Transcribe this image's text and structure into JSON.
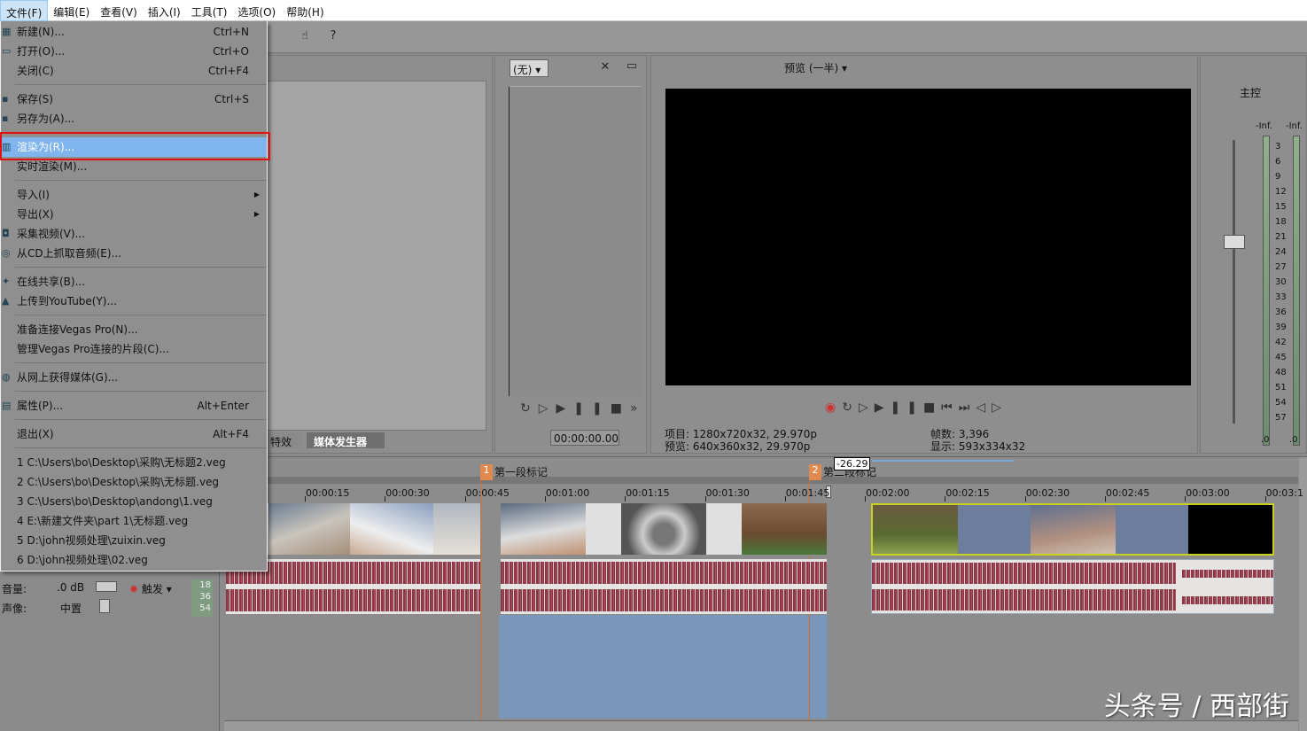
{
  "menubar": [
    "文件(F)",
    "编辑(E)",
    "查看(V)",
    "插入(I)",
    "工具(T)",
    "选项(O)",
    "帮助(H)"
  ],
  "file_menu": [
    {
      "label": "新建(N)...",
      "shortcut": "Ctrl+N",
      "icon": "new-project-icon"
    },
    {
      "label": "打开(O)...",
      "shortcut": "Ctrl+O",
      "icon": "folder-icon"
    },
    {
      "label": "关闭(C)",
      "shortcut": "Ctrl+F4"
    },
    {
      "sep": true
    },
    {
      "label": "保存(S)",
      "shortcut": "Ctrl+S",
      "icon": "save-icon"
    },
    {
      "label": "另存为(A)...",
      "icon": "save-as-icon"
    },
    {
      "sep": true
    },
    {
      "label": "渲染为(R)...",
      "icon": "render-icon",
      "highlighted": true
    },
    {
      "label": "实时渲染(M)..."
    },
    {
      "sep": true
    },
    {
      "label": "导入(I)",
      "submenu": true
    },
    {
      "label": "导出(X)",
      "submenu": true
    },
    {
      "label": "采集视频(V)...",
      "icon": "capture-video-icon"
    },
    {
      "label": "从CD上抓取音频(E)...",
      "icon": "cd-icon"
    },
    {
      "sep": true
    },
    {
      "label": "在线共享(B)...",
      "icon": "share-icon"
    },
    {
      "label": "上传到YouTube(Y)...",
      "icon": "upload-icon"
    },
    {
      "sep": true
    },
    {
      "label": "准备连接Vegas Pro(N)..."
    },
    {
      "label": "管理Vegas Pro连接的片段(C)..."
    },
    {
      "sep": true
    },
    {
      "label": "从网上获得媒体(G)...",
      "icon": "web-media-icon"
    },
    {
      "sep": true
    },
    {
      "label": "属性(P)...",
      "shortcut": "Alt+Enter",
      "icon": "properties-icon"
    },
    {
      "sep": true
    },
    {
      "label": "退出(X)",
      "shortcut": "Alt+F4"
    },
    {
      "sep": true
    },
    {
      "label": "1 C:\\Users\\bo\\Desktop\\采购\\无标题2.veg"
    },
    {
      "label": "2 C:\\Users\\bo\\Desktop\\采购\\无标题.veg"
    },
    {
      "label": "3 C:\\Users\\bo\\Desktop\\andong\\1.veg"
    },
    {
      "label": "4 E:\\新建文件夹\\part 1\\无标题.veg"
    },
    {
      "label": "5 D:\\john视频处理\\zuixin.veg"
    },
    {
      "label": "6 D:\\john视频处理\\02.veg"
    }
  ],
  "explorer": {
    "tabs": [
      "特效",
      "媒体发生器"
    ],
    "active_tab": "媒体发生器"
  },
  "trimmer": {
    "dropdown": "(无)",
    "time": "00:00:00.00"
  },
  "preview": {
    "mode": "预览 (一半)",
    "project": "项目: 1280x720x32, 29.970p",
    "preview_info": "预览: 640x360x32, 29.970p",
    "frames": "帧数: 3,396",
    "display": "显示: 593x334x32"
  },
  "master": {
    "title": "主控",
    "inf_left": "-Inf.",
    "inf_right": "-Inf.",
    "scale": [
      "3",
      "6",
      "9",
      "12",
      "15",
      "18",
      "21",
      "24",
      "27",
      "30",
      "33",
      "36",
      "39",
      "42",
      "45",
      "48",
      "51",
      "54",
      "57"
    ],
    "zero_left": ".0",
    "zero_right": ".0"
  },
  "timeline": {
    "markers": [
      {
        "num": "1",
        "label": "第一段标记"
      },
      {
        "num": "2",
        "label": "第二段标记"
      }
    ],
    "drag_value": "-26.29",
    "ruler": [
      "00:00:15",
      "00:00:30",
      "00:00:45",
      "00:01:00",
      "00:01:15",
      "00:01:30",
      "00:01:45",
      "00:02:00",
      "00:02:15",
      "00:02:30",
      "00:02:45",
      "00:03:00",
      "00:03:1"
    ],
    "audio_header": {
      "volume_label": "音量:",
      "volume": ".0 dB",
      "pan_label": "声像:",
      "pan": "中置",
      "trigger": "触发",
      "meter": [
        "18",
        "36",
        "54"
      ]
    }
  },
  "watermark": "头条号 / 西部街",
  "colors": {
    "highlight": "#7fb4ec",
    "render_box": "#e01010",
    "waveform": "#8c3545",
    "selection": "#7a96b8",
    "selected_clip_border": "#c8d020"
  }
}
